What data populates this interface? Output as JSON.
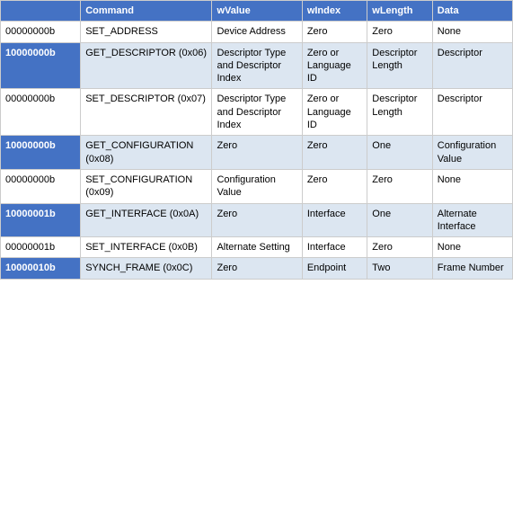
{
  "table": {
    "headers": [
      "",
      "Command",
      "wValue",
      "wIndex",
      "wLength",
      "Data"
    ],
    "rows": [
      {
        "style": "light",
        "cells": [
          "00000000b",
          "SET_ADDRESS",
          "Device Address",
          "Zero",
          "Zero",
          "None"
        ]
      },
      {
        "style": "dark",
        "cells": [
          "10000000b",
          "GET_DESCRIPTOR (0x06)",
          "Descriptor Type and Descriptor Index",
          "Zero or Language ID",
          "Descriptor Length",
          "Descriptor"
        ]
      },
      {
        "style": "light",
        "cells": [
          "00000000b",
          "SET_DESCRIPTOR (0x07)",
          "Descriptor Type and Descriptor Index",
          "Zero or Language ID",
          "Descriptor Length",
          "Descriptor"
        ]
      },
      {
        "style": "dark",
        "cells": [
          "10000000b",
          "GET_CONFIGURATION (0x08)",
          "Zero",
          "Zero",
          "One",
          "Configuration Value"
        ]
      },
      {
        "style": "light",
        "cells": [
          "00000000b",
          "SET_CONFIGURATION (0x09)",
          "Configuration Value",
          "Zero",
          "Zero",
          "None"
        ]
      },
      {
        "style": "dark",
        "cells": [
          "10000001b",
          "GET_INTERFACE (0x0A)",
          "Zero",
          "Interface",
          "One",
          "Alternate Interface"
        ]
      },
      {
        "style": "light",
        "cells": [
          "00000001b",
          "SET_INTERFACE (0x0B)",
          "Alternate Setting",
          "Interface",
          "Zero",
          "None"
        ]
      },
      {
        "style": "dark",
        "cells": [
          "10000010b",
          "SYNCH_FRAME (0x0C)",
          "Zero",
          "Endpoint",
          "Two",
          "Frame Number"
        ]
      }
    ]
  }
}
